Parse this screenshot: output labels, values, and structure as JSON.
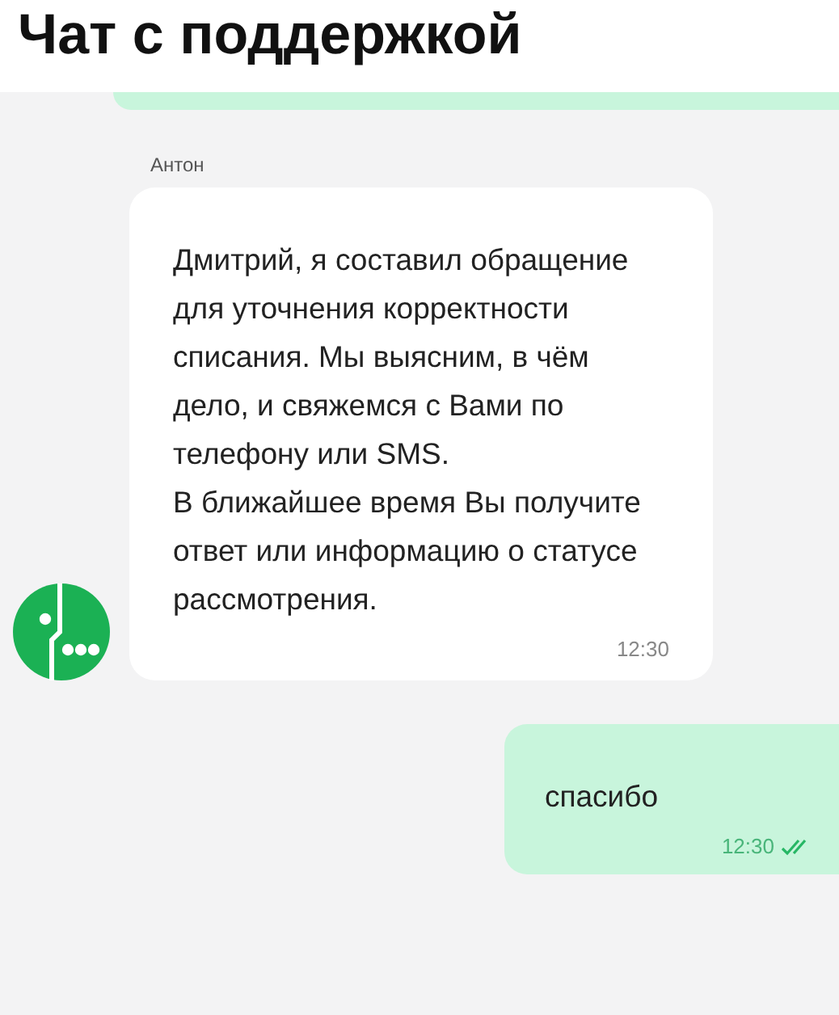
{
  "header": {
    "title": "Чат с поддержкой"
  },
  "messages": [
    {
      "kind": "incoming",
      "author": "Антон",
      "paragraphs": [
        "Дмитрий, я составил обращение для уточнения корректности списания. Мы выясним, в чём дело, и свяжемся с Вами по телефону или SMS.",
        "В ближайшее время Вы получите ответ или информацию о статусе рассмотрения."
      ],
      "time": "12:30"
    },
    {
      "kind": "outgoing",
      "paragraphs": [
        "спасибо"
      ],
      "time": "12:30",
      "read": true
    }
  ]
}
